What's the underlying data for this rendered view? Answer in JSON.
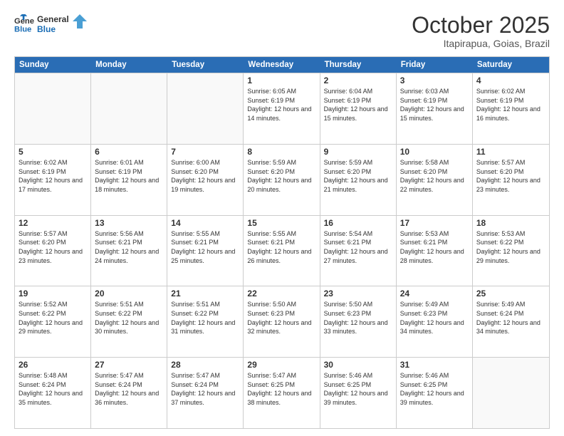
{
  "header": {
    "logo_line1": "General",
    "logo_line2": "Blue",
    "month": "October 2025",
    "location": "Itapirapua, Goias, Brazil"
  },
  "days_of_week": [
    "Sunday",
    "Monday",
    "Tuesday",
    "Wednesday",
    "Thursday",
    "Friday",
    "Saturday"
  ],
  "weeks": [
    [
      {
        "day": "",
        "empty": true
      },
      {
        "day": "",
        "empty": true
      },
      {
        "day": "",
        "empty": true
      },
      {
        "day": "1",
        "sunrise": "6:05 AM",
        "sunset": "6:19 PM",
        "daylight": "12 hours and 14 minutes."
      },
      {
        "day": "2",
        "sunrise": "6:04 AM",
        "sunset": "6:19 PM",
        "daylight": "12 hours and 15 minutes."
      },
      {
        "day": "3",
        "sunrise": "6:03 AM",
        "sunset": "6:19 PM",
        "daylight": "12 hours and 15 minutes."
      },
      {
        "day": "4",
        "sunrise": "6:02 AM",
        "sunset": "6:19 PM",
        "daylight": "12 hours and 16 minutes."
      }
    ],
    [
      {
        "day": "5",
        "sunrise": "6:02 AM",
        "sunset": "6:19 PM",
        "daylight": "12 hours and 17 minutes."
      },
      {
        "day": "6",
        "sunrise": "6:01 AM",
        "sunset": "6:19 PM",
        "daylight": "12 hours and 18 minutes."
      },
      {
        "day": "7",
        "sunrise": "6:00 AM",
        "sunset": "6:20 PM",
        "daylight": "12 hours and 19 minutes."
      },
      {
        "day": "8",
        "sunrise": "5:59 AM",
        "sunset": "6:20 PM",
        "daylight": "12 hours and 20 minutes."
      },
      {
        "day": "9",
        "sunrise": "5:59 AM",
        "sunset": "6:20 PM",
        "daylight": "12 hours and 21 minutes."
      },
      {
        "day": "10",
        "sunrise": "5:58 AM",
        "sunset": "6:20 PM",
        "daylight": "12 hours and 22 minutes."
      },
      {
        "day": "11",
        "sunrise": "5:57 AM",
        "sunset": "6:20 PM",
        "daylight": "12 hours and 23 minutes."
      }
    ],
    [
      {
        "day": "12",
        "sunrise": "5:57 AM",
        "sunset": "6:20 PM",
        "daylight": "12 hours and 23 minutes."
      },
      {
        "day": "13",
        "sunrise": "5:56 AM",
        "sunset": "6:21 PM",
        "daylight": "12 hours and 24 minutes."
      },
      {
        "day": "14",
        "sunrise": "5:55 AM",
        "sunset": "6:21 PM",
        "daylight": "12 hours and 25 minutes."
      },
      {
        "day": "15",
        "sunrise": "5:55 AM",
        "sunset": "6:21 PM",
        "daylight": "12 hours and 26 minutes."
      },
      {
        "day": "16",
        "sunrise": "5:54 AM",
        "sunset": "6:21 PM",
        "daylight": "12 hours and 27 minutes."
      },
      {
        "day": "17",
        "sunrise": "5:53 AM",
        "sunset": "6:21 PM",
        "daylight": "12 hours and 28 minutes."
      },
      {
        "day": "18",
        "sunrise": "5:53 AM",
        "sunset": "6:22 PM",
        "daylight": "12 hours and 29 minutes."
      }
    ],
    [
      {
        "day": "19",
        "sunrise": "5:52 AM",
        "sunset": "6:22 PM",
        "daylight": "12 hours and 29 minutes."
      },
      {
        "day": "20",
        "sunrise": "5:51 AM",
        "sunset": "6:22 PM",
        "daylight": "12 hours and 30 minutes."
      },
      {
        "day": "21",
        "sunrise": "5:51 AM",
        "sunset": "6:22 PM",
        "daylight": "12 hours and 31 minutes."
      },
      {
        "day": "22",
        "sunrise": "5:50 AM",
        "sunset": "6:23 PM",
        "daylight": "12 hours and 32 minutes."
      },
      {
        "day": "23",
        "sunrise": "5:50 AM",
        "sunset": "6:23 PM",
        "daylight": "12 hours and 33 minutes."
      },
      {
        "day": "24",
        "sunrise": "5:49 AM",
        "sunset": "6:23 PM",
        "daylight": "12 hours and 34 minutes."
      },
      {
        "day": "25",
        "sunrise": "5:49 AM",
        "sunset": "6:24 PM",
        "daylight": "12 hours and 34 minutes."
      }
    ],
    [
      {
        "day": "26",
        "sunrise": "5:48 AM",
        "sunset": "6:24 PM",
        "daylight": "12 hours and 35 minutes."
      },
      {
        "day": "27",
        "sunrise": "5:47 AM",
        "sunset": "6:24 PM",
        "daylight": "12 hours and 36 minutes."
      },
      {
        "day": "28",
        "sunrise": "5:47 AM",
        "sunset": "6:24 PM",
        "daylight": "12 hours and 37 minutes."
      },
      {
        "day": "29",
        "sunrise": "5:47 AM",
        "sunset": "6:25 PM",
        "daylight": "12 hours and 38 minutes."
      },
      {
        "day": "30",
        "sunrise": "5:46 AM",
        "sunset": "6:25 PM",
        "daylight": "12 hours and 39 minutes."
      },
      {
        "day": "31",
        "sunrise": "5:46 AM",
        "sunset": "6:25 PM",
        "daylight": "12 hours and 39 minutes."
      },
      {
        "day": "",
        "empty": true
      }
    ]
  ]
}
